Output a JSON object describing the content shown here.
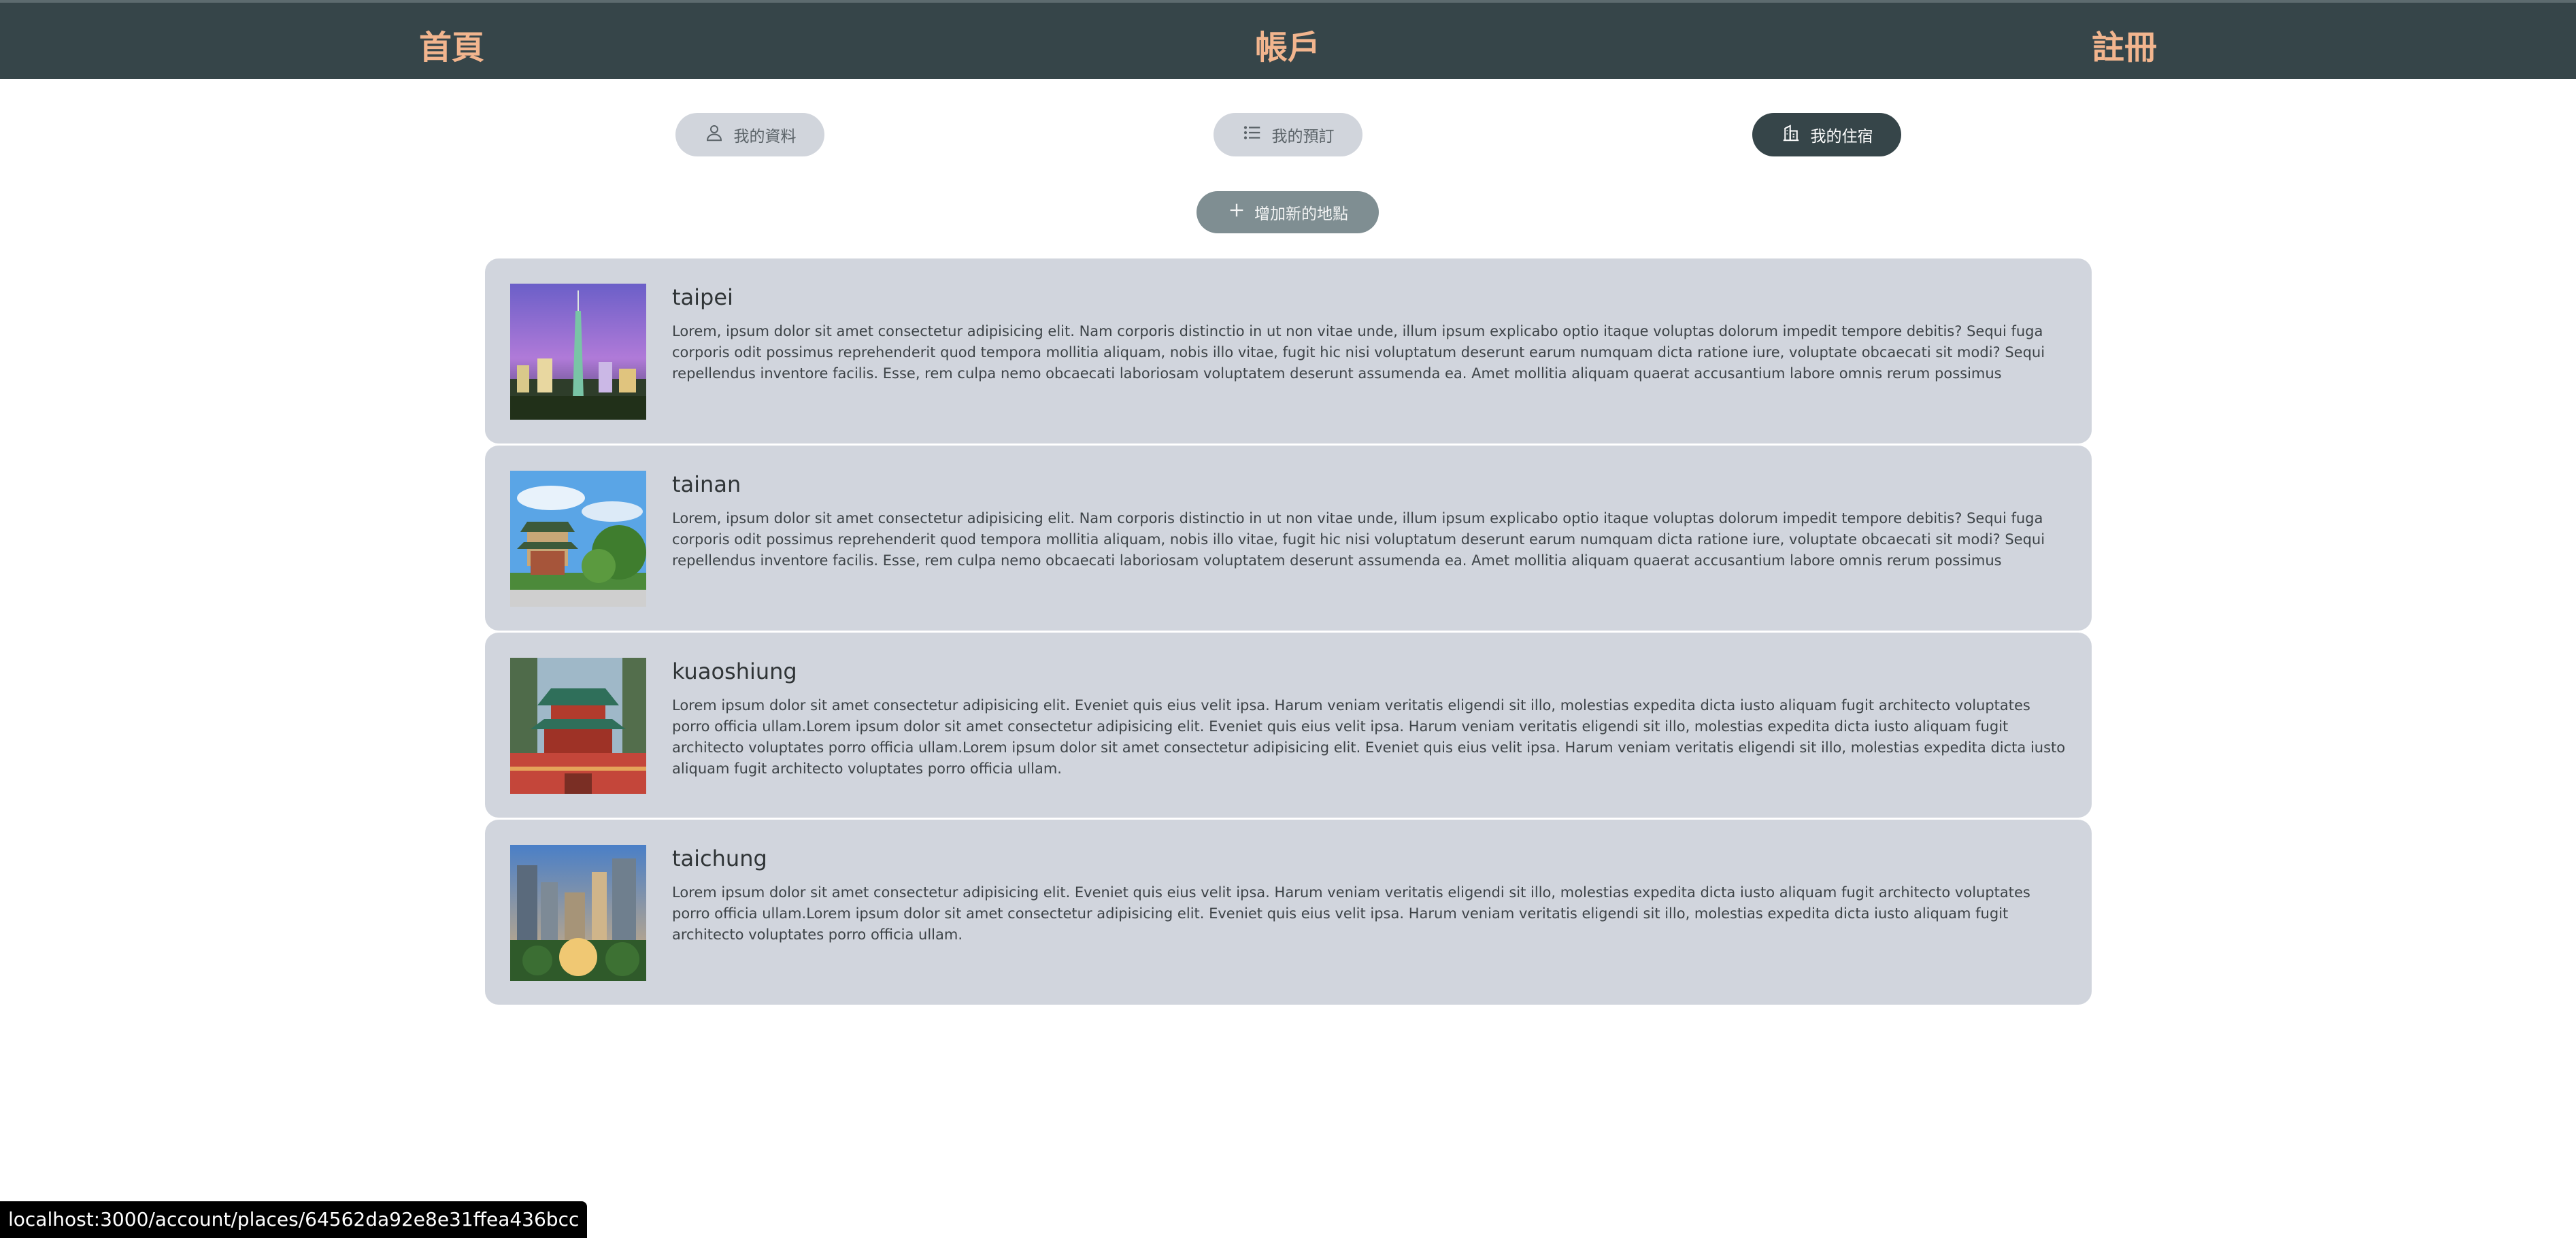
{
  "nav": {
    "home": "首頁",
    "account": "帳戶",
    "register": "註冊"
  },
  "tabs": [
    {
      "label": "我的資料",
      "icon": "user-icon",
      "active": false
    },
    {
      "label": "我的預訂",
      "icon": "list-icon",
      "active": false
    },
    {
      "label": "我的住宿",
      "icon": "building-icon",
      "active": true
    }
  ],
  "add_place": {
    "label": "增加新的地點",
    "icon": "plus-icon"
  },
  "places": [
    {
      "title": "taipei",
      "description": "Lorem, ipsum dolor sit amet consectetur adipisicing elit. Nam corporis distinctio in ut non vitae unde, illum ipsum explicabo optio itaque voluptas dolorum impedit tempore debitis? Sequi fuga corporis odit possimus reprehenderit quod tempora mollitia aliquam, nobis illo vitae, fugit hic nisi voluptatum deserunt earum numquam dicta ratione iure, voluptate obcaecati sit modi? Sequi repellendus inventore facilis. Esse, rem culpa nemo obcaecati laboriosam voluptatem deserunt assumenda ea. Amet mollitia aliquam quaerat accusantium labore omnis rerum possimus"
    },
    {
      "title": "tainan",
      "description": "Lorem, ipsum dolor sit amet consectetur adipisicing elit. Nam corporis distinctio in ut non vitae unde, illum ipsum explicabo optio itaque voluptas dolorum impedit tempore debitis? Sequi fuga corporis odit possimus reprehenderit quod tempora mollitia aliquam, nobis illo vitae, fugit hic nisi voluptatum deserunt earum numquam dicta ratione iure, voluptate obcaecati sit modi? Sequi repellendus inventore facilis. Esse, rem culpa nemo obcaecati laboriosam voluptatem deserunt assumenda ea. Amet mollitia aliquam quaerat accusantium labore omnis rerum possimus"
    },
    {
      "title": "kuaoshiung",
      "description": "Lorem ipsum dolor sit amet consectetur adipisicing elit. Eveniet quis eius velit ipsa. Harum veniam veritatis eligendi sit illo, molestias expedita dicta iusto aliquam fugit architecto voluptates porro officia ullam.Lorem ipsum dolor sit amet consectetur adipisicing elit. Eveniet quis eius velit ipsa. Harum veniam veritatis eligendi sit illo, molestias expedita dicta iusto aliquam fugit architecto voluptates porro officia ullam.Lorem ipsum dolor sit amet consectetur adipisicing elit. Eveniet quis eius velit ipsa. Harum veniam veritatis eligendi sit illo, molestias expedita dicta iusto aliquam fugit architecto voluptates porro officia ullam."
    },
    {
      "title": "taichung",
      "description": "Lorem ipsum dolor sit amet consectetur adipisicing elit. Eveniet quis eius velit ipsa. Harum veniam veritatis eligendi sit illo, molestias expedita dicta iusto aliquam fugit architecto voluptates porro officia ullam.Lorem ipsum dolor sit amet consectetur adipisicing elit. Eveniet quis eius velit ipsa. Harum veniam veritatis eligendi sit illo, molestias expedita dicta iusto aliquam fugit architecto voluptates porro officia ullam."
    }
  ],
  "status_bar": {
    "url": "localhost:3000/account/places/64562da92e8e31ffea436bcc"
  },
  "colors": {
    "header_bg": "#364549",
    "nav_text": "#f2b58e",
    "card_bg": "#d1d5dd",
    "active_tab": "#364549"
  }
}
